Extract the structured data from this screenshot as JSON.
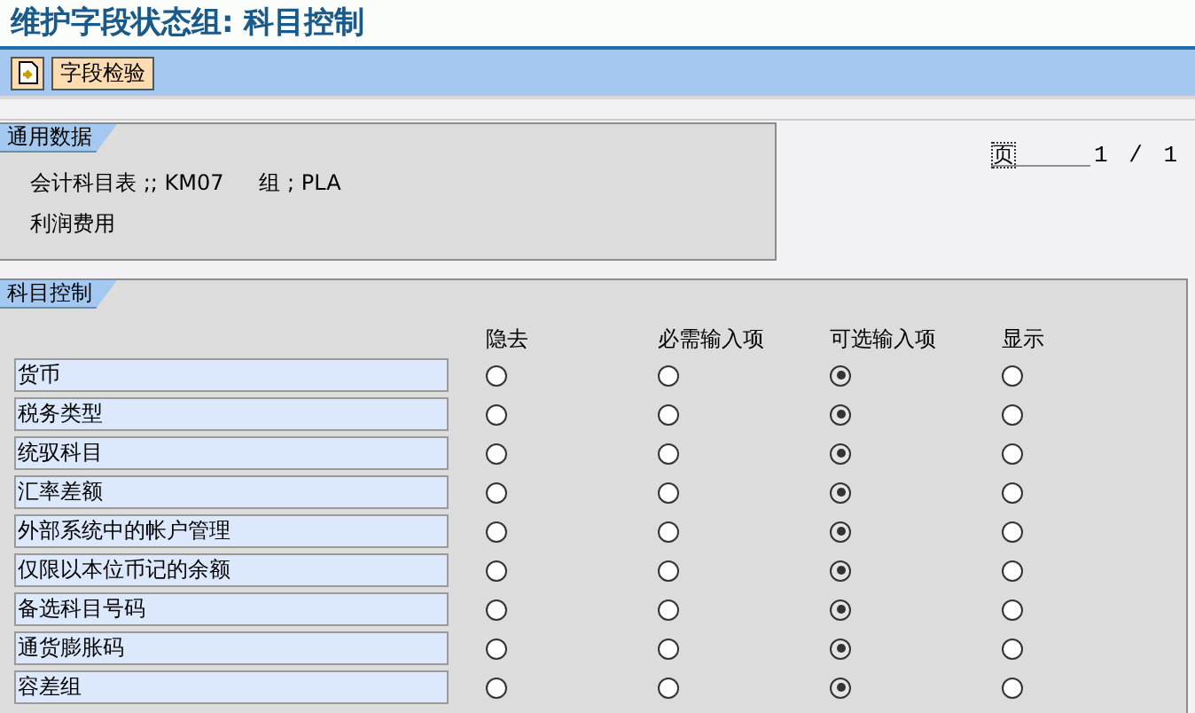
{
  "title": "维护字段状态组: 科目控制",
  "toolbar": {
    "buttons": [
      {
        "kind": "icon"
      },
      {
        "kind": "text",
        "label": "字段检验"
      }
    ]
  },
  "general_data": {
    "tab": "通用数据",
    "chart_of_accounts": "会计科目表 ;; KM07",
    "group": "组 ; PLA",
    "description": "利润费用"
  },
  "pager": {
    "label": "页",
    "value": "1 / 1"
  },
  "account_control": {
    "tab": "科目控制",
    "columns": [
      "隐去",
      "必需输入项",
      "可选输入项",
      "显示"
    ],
    "rows": [
      {
        "label": "货币",
        "options": [
          {
            "selected": false
          },
          {
            "selected": false
          },
          {
            "selected": true
          },
          {
            "selected": false
          }
        ]
      },
      {
        "label": "税务类型",
        "options": [
          {
            "selected": false
          },
          {
            "selected": false
          },
          {
            "selected": true
          },
          {
            "selected": false
          }
        ]
      },
      {
        "label": "统驭科目",
        "options": [
          {
            "selected": false
          },
          {
            "selected": false
          },
          {
            "selected": true
          },
          {
            "selected": false
          }
        ]
      },
      {
        "label": "汇率差额",
        "options": [
          {
            "selected": false
          },
          {
            "selected": false
          },
          {
            "selected": true
          },
          {
            "selected": false
          }
        ]
      },
      {
        "label": "外部系统中的帐户管理",
        "options": [
          {
            "selected": false
          },
          {
            "selected": false
          },
          {
            "selected": true
          },
          {
            "selected": false
          }
        ]
      },
      {
        "label": "仅限以本位币记的余额",
        "options": [
          {
            "selected": false
          },
          {
            "selected": false
          },
          {
            "selected": true
          },
          {
            "selected": false
          }
        ]
      },
      {
        "label": "备选科目号码",
        "options": [
          {
            "selected": false
          },
          {
            "selected": false
          },
          {
            "selected": true
          },
          {
            "selected": false
          }
        ]
      },
      {
        "label": "通货膨胀码",
        "options": [
          {
            "selected": false
          },
          {
            "selected": false
          },
          {
            "selected": true
          },
          {
            "selected": false
          }
        ]
      },
      {
        "label": "容差组",
        "options": [
          {
            "selected": false
          },
          {
            "selected": false
          },
          {
            "selected": true
          },
          {
            "selected": false
          }
        ]
      }
    ]
  }
}
